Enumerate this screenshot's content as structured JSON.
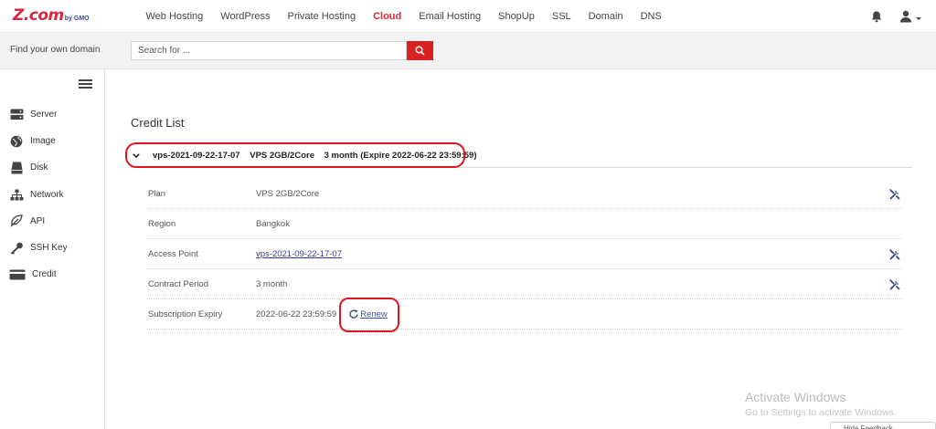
{
  "header": {
    "logo": "Z.com",
    "logo_sub": "by GMO",
    "nav": [
      {
        "label": "Web Hosting",
        "active": false
      },
      {
        "label": "WordPress",
        "active": false
      },
      {
        "label": "Private Hosting",
        "active": false
      },
      {
        "label": "Cloud",
        "active": true
      },
      {
        "label": "Email Hosting",
        "active": false
      },
      {
        "label": "ShopUp",
        "active": false
      },
      {
        "label": "SSL",
        "active": false
      },
      {
        "label": "Domain",
        "active": false
      },
      {
        "label": "DNS",
        "active": false
      }
    ],
    "icons": [
      "bell-icon",
      "user-icon"
    ]
  },
  "search": {
    "label": "Find your own domain",
    "placeholder": "Search for ...",
    "button_icon": "search-icon"
  },
  "sidebar": {
    "items": [
      {
        "label": "Server",
        "icon": "server-icon"
      },
      {
        "label": "Image",
        "icon": "globe-icon"
      },
      {
        "label": "Disk",
        "icon": "disk-icon"
      },
      {
        "label": "Network",
        "icon": "network-icon"
      },
      {
        "label": "API",
        "icon": "leaf-icon"
      },
      {
        "label": "SSH Key",
        "icon": "key-icon"
      },
      {
        "label": "Credit",
        "icon": "credit-card-icon"
      }
    ]
  },
  "main": {
    "title": "Credit List",
    "credit": {
      "name": "vps-2021-09-22-17-07",
      "plan": "VPS 2GB/2Core",
      "period": "3 month (Expire 2022-06-22 23:59:59)"
    },
    "details": {
      "plan": {
        "label": "Plan",
        "value": "VPS 2GB/2Core"
      },
      "region": {
        "label": "Region",
        "value": "Bangkok"
      },
      "access_point": {
        "label": "Access Point",
        "value": "vps-2021-09-22-17-07"
      },
      "contract_period": {
        "label": "Contract Period",
        "value": "3 month"
      },
      "expiry": {
        "label": "Subscription Expiry",
        "value": "2022-06-22 23:59:59",
        "action": "Renew"
      }
    }
  },
  "watermark": {
    "title": "Activate Windows",
    "subtitle": "Go to Settings to activate Windows.",
    "corner": "Hide Feedback"
  },
  "colors": {
    "brand_red": "#d7263d",
    "search_button": "#d92121",
    "highlight": "#e0141e",
    "link_blue": "#3355aa"
  }
}
